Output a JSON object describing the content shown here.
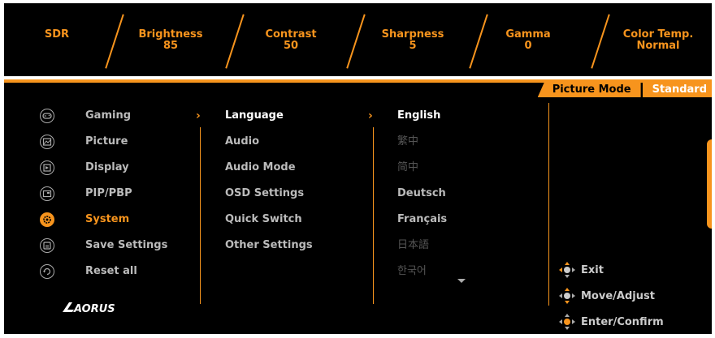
{
  "top": {
    "sdr": {
      "label": "SDR"
    },
    "brightness": {
      "label": "Brightness",
      "value": "85"
    },
    "contrast": {
      "label": "Contrast",
      "value": "50"
    },
    "sharpness": {
      "label": "Sharpness",
      "value": "5"
    },
    "gamma": {
      "label": "Gamma",
      "value": "0"
    },
    "colortemp": {
      "label": "Color Temp.",
      "value": "Normal"
    }
  },
  "mode": {
    "label": "Picture Mode",
    "value": "Standard"
  },
  "main_menu": [
    {
      "label": "Gaming",
      "icon": "gamepad-icon"
    },
    {
      "label": "Picture",
      "icon": "picture-icon"
    },
    {
      "label": "Display",
      "icon": "display-icon"
    },
    {
      "label": "PIP/PBP",
      "icon": "pip-icon"
    },
    {
      "label": "System",
      "icon": "gear-icon"
    },
    {
      "label": "Save Settings",
      "icon": "save-icon"
    },
    {
      "label": "Reset all",
      "icon": "reset-icon"
    }
  ],
  "sub_menu": [
    "Language",
    "Audio",
    "Audio Mode",
    "OSD Settings",
    "Quick Switch",
    "Other Settings"
  ],
  "options": [
    "English",
    "繁中",
    "简中",
    "Deutsch",
    "Français",
    "日本語",
    "한국어"
  ],
  "brand": "AORUS",
  "hints": {
    "exit": "Exit",
    "move": "Move/Adjust",
    "enter": "Enter/Confirm"
  },
  "colors": {
    "accent": "#f7941d",
    "background": "#000000"
  }
}
